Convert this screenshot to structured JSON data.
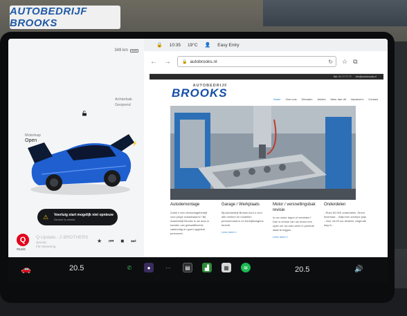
{
  "environment": {
    "sign_text": "AUTOBEDRIJF BROOKS"
  },
  "car_panel": {
    "range": "349 km",
    "trunk_label": "Achterbak",
    "trunk_state": "Geopend",
    "frunk_label": "Motorkap",
    "frunk_state": "Open",
    "alert_title": "Voertuig start mogelijk niet opnieuw",
    "alert_subtitle": "Service is vereist",
    "media": {
      "logo": "Q",
      "logo_label": "music",
      "title": "Q-Update - 2 BROTHERS",
      "subtitle": "Qmusic",
      "source": "FM Streaming"
    }
  },
  "status_bar": {
    "time": "10:35",
    "temperature": "19°C",
    "profile": "Easy Entry"
  },
  "browser": {
    "url": "autobrooks.nl",
    "site": {
      "topbar_phone": "Bel: 0?-?? ?? ??",
      "topbar_email": "info@autobrooks.nl",
      "brand_top": "AUTOBEDRIJF",
      "brand_main": "BROOKS",
      "nav": [
        "Home",
        "Over ons",
        "Diensten",
        "Advies",
        "Meer dan dit",
        "Vacature's",
        "Contact"
      ],
      "columns": [
        {
          "title": "Autodemontage",
          "text": "Zoekt u een demontagebedrijf voor jonge schadeauto's? Bij Autobedrijf Brooks is uw auto in handen van gekwalificeerd, vakkundig en goed opgeleid personeel.",
          "more": ""
        },
        {
          "title": "Garage / Werkplaats",
          "text": "Bij Autobedrijf Brooks kunt u voor alle merken en modellen personenauto's en bedrijfswagens terecht.",
          "more": "Lees meer »"
        },
        {
          "title": "Motor / versnellingsbak revisie",
          "text": "Is uw motor kapot of versleten? Dan is revisie van uw motor een optie om uw auto weer in perfecte staat te krijgen.",
          "more": "Lees meer »"
        },
        {
          "title": "Onderdelen",
          "text": "- Ruim 50.000 onderdelen. Direct leverbaar. - Altijd een scherpe prijs - Voor 16:00 uur besteld, volgende dag in...",
          "more": ""
        }
      ]
    }
  },
  "dock": {
    "temp_left": "20.5",
    "temp_right": "20.5"
  },
  "icons": {
    "car": "car-icon",
    "lock": "unlock-icon",
    "alert": "warning-icon",
    "phone": "phone-icon",
    "camera": "camera-icon",
    "volume": "volume-icon"
  },
  "colors": {
    "brand_blue": "#174ea6",
    "car_blue": "#1f5fd0",
    "alert_yellow": "#f1c40f",
    "nav_active": "#0a7cc4"
  }
}
